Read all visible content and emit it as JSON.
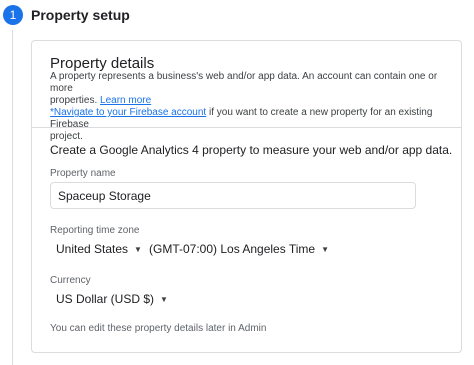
{
  "step": {
    "number": "1",
    "title": "Property setup"
  },
  "card": {
    "title": "Property details",
    "desc_line1": "A property represents a business's web and/or app data. An account can contain one or more",
    "desc_line2_prefix": "properties. ",
    "learn_more": "Learn more",
    "firebase_link": "*Navigate to your Firebase account",
    "firebase_suffix": " if you want to create a new property for an existing Firebase",
    "desc_line4": "project.",
    "intro": "Create a Google Analytics 4 property to measure your web and/or app data.",
    "property_name_label": "Property name",
    "property_name_value": "Spaceup Storage",
    "time_zone_label": "Reporting time zone",
    "country_value": "United States",
    "time_zone_value": "(GMT-07:00) Los Angeles Time",
    "currency_label": "Currency",
    "currency_value": "US Dollar (USD $)",
    "footer_note": "You can edit these property details later in Admin"
  },
  "colors": {
    "accent": "#1a73e8",
    "border": "#dadce0"
  },
  "icons": {
    "dropdown": "caret-down-icon"
  }
}
